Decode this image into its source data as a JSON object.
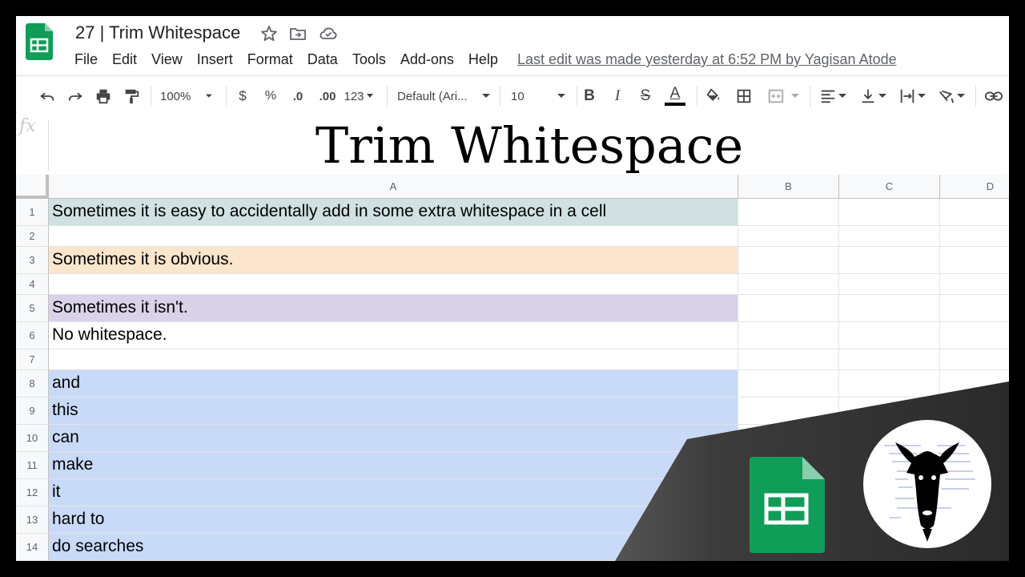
{
  "doc": {
    "title": "27 | Trim Whitespace",
    "last_edit": "Last edit was made yesterday at 6:52 PM by Yagisan Atode"
  },
  "header_icons": [
    "star-icon",
    "move-to-folder-icon",
    "cloud-status-icon"
  ],
  "menu": [
    "File",
    "Edit",
    "View",
    "Insert",
    "Format",
    "Data",
    "Tools",
    "Add-ons",
    "Help"
  ],
  "toolbar": {
    "zoom": "100%",
    "currency": "$",
    "percent": "%",
    "decrease_decimal": ".0",
    "increase_decimal": ".00",
    "more_formats": "123",
    "font": "Default (Ari...",
    "font_size": "10",
    "bold": "B",
    "italic": "I",
    "strikethrough": "S",
    "text_color": "A"
  },
  "formula_bar": {
    "fx": "fx",
    "content": "Trim Whitespace"
  },
  "columns": [
    "A",
    "B",
    "C",
    "D"
  ],
  "rows": [
    {
      "num": "1",
      "a": "Sometimes it is easy to accidentally add in some extra whitespace in a cell",
      "fill": "#d0e0e3"
    },
    {
      "num": "2",
      "a": "",
      "fill": ""
    },
    {
      "num": "3",
      "a": "Sometimes it is obvious.",
      "fill": "#fce5cd"
    },
    {
      "num": "4",
      "a": "",
      "fill": ""
    },
    {
      "num": "5",
      "a": "Sometimes it isn't.",
      "fill": "#d9d2e9"
    },
    {
      "num": "6",
      "a": "No whitespace.",
      "fill": ""
    },
    {
      "num": "7",
      "a": "",
      "fill": ""
    },
    {
      "num": "8",
      "a": "and",
      "fill": "#c9daf8"
    },
    {
      "num": "9",
      "a": "this",
      "fill": "#c9daf8"
    },
    {
      "num": "10",
      "a": "can",
      "fill": "#c9daf8"
    },
    {
      "num": "11",
      "a": "make",
      "fill": "#c9daf8"
    },
    {
      "num": "12",
      "a": "it",
      "fill": "#c9daf8"
    },
    {
      "num": "13",
      "a": "hard to",
      "fill": "#c9daf8"
    },
    {
      "num": "14",
      "a": "do searches",
      "fill": "#c9daf8"
    }
  ],
  "colors": {
    "sheets_green": "#0f9d58",
    "text_color_bar": "#000000"
  }
}
